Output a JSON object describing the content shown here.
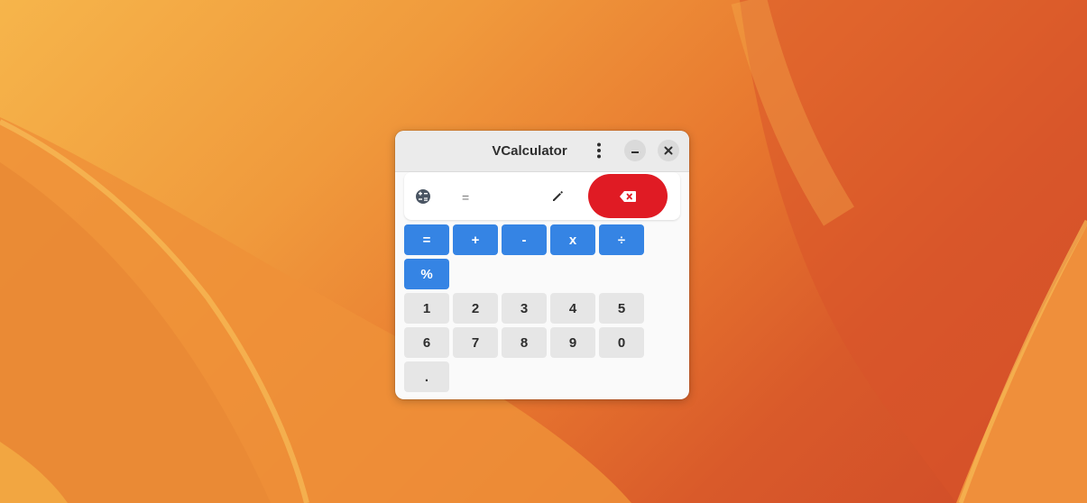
{
  "window": {
    "title": "VCalculator"
  },
  "display": {
    "expression_placeholder": "=",
    "expression_value": ""
  },
  "icons": {
    "menu": "vertical-dots-icon",
    "minimize": "minimize-icon",
    "close": "close-icon",
    "mode": "calculator-mode-icon",
    "edit": "pencil-icon",
    "backspace": "backspace-icon"
  },
  "colors": {
    "accent": "#3584e4",
    "destructive": "#e01b24",
    "number_key": "#e6e6e6"
  },
  "keys": {
    "ops": [
      "=",
      "+",
      "-",
      "x",
      "÷",
      "%"
    ],
    "digits": [
      "1",
      "2",
      "3",
      "4",
      "5",
      "6",
      "7",
      "8",
      "9",
      "0",
      "."
    ]
  }
}
